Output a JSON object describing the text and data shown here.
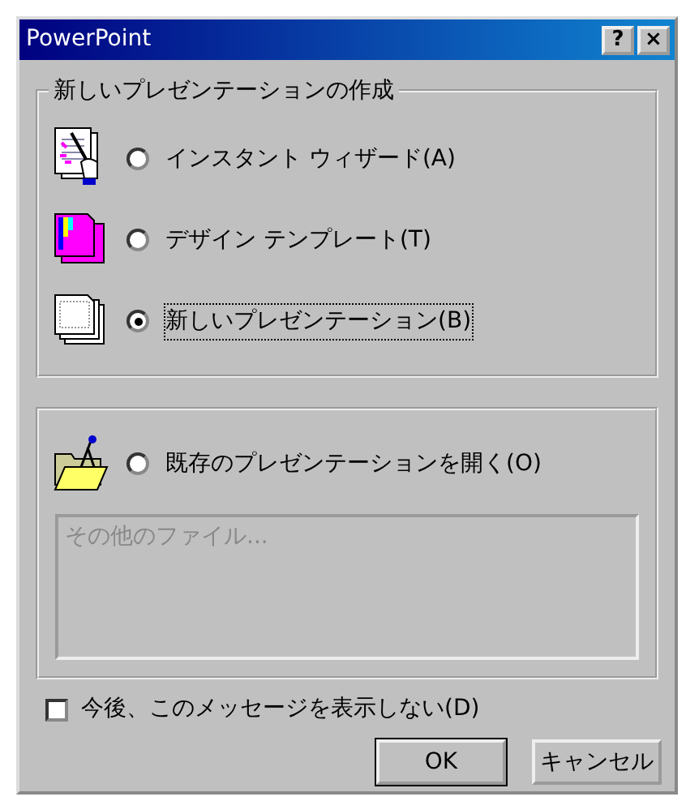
{
  "window": {
    "title": "PowerPoint",
    "title_buttons": [
      "?",
      "×"
    ]
  },
  "create_group": {
    "legend": "新しいプレゼンテーションの作成",
    "options": [
      {
        "label": "インスタント ウィザード(A)",
        "selected": false
      },
      {
        "label": "デザイン テンプレート(T)",
        "selected": false
      },
      {
        "label": "新しいプレゼンテーション(B)",
        "selected": true
      }
    ]
  },
  "open_group": {
    "option": {
      "label": "既存のプレゼンテーションを開く(O)",
      "selected": false
    },
    "file_list": {
      "items": [
        {
          "label": "その他のファイル...",
          "disabled": true
        }
      ]
    }
  },
  "dont_show": {
    "label": "今後、このメッセージを表示しない(D)",
    "checked": false
  },
  "buttons": [
    {
      "label": "OK",
      "default": true
    },
    {
      "label": "キャンセル",
      "default": false
    }
  ]
}
